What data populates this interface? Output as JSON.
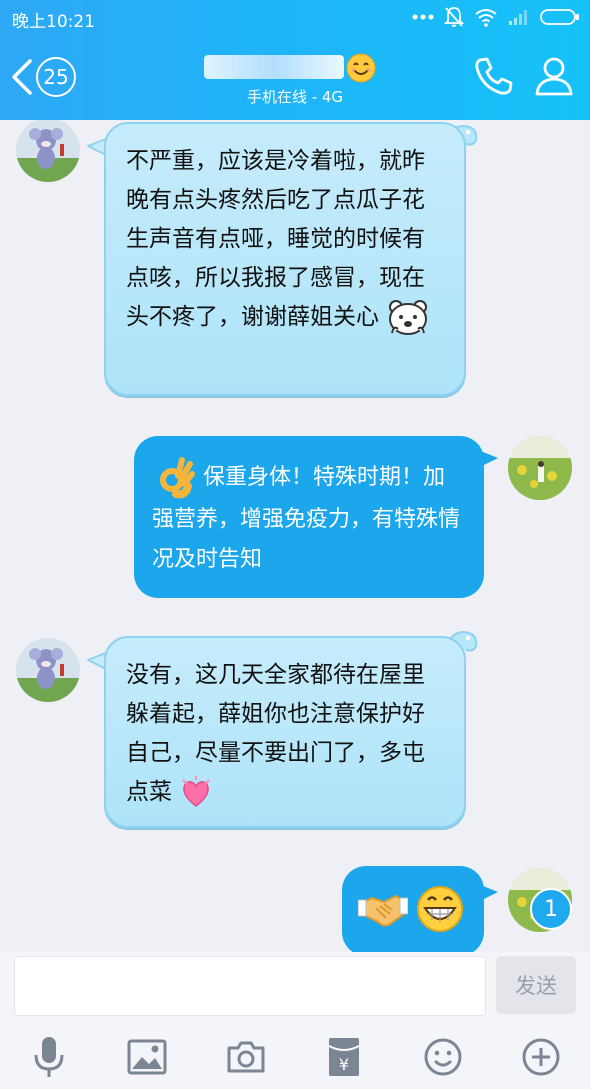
{
  "status_bar": {
    "time": "晚上10:21"
  },
  "header": {
    "unread_count": "25",
    "contact_status": "手机在线 - 4G"
  },
  "messages": [
    {
      "direction": "incoming",
      "text": "不严重，应该是冷着啦，就昨晚有点头疼然后吃了点瓜子花生声音有点哑，睡觉的时候有点咳，所以我报了感冒，现在头不疼了，谢谢薛姐关心"
    },
    {
      "direction": "outgoing",
      "text": "保重身体！特殊时期！加强营养，增强免疫力，有特殊情况及时告知"
    },
    {
      "direction": "incoming",
      "text": "没有，这几天全家都待在屋里躲着起，薛姐你也注意保护好自己，尽量不要出门了，多屯点菜"
    },
    {
      "direction": "outgoing",
      "text": ""
    }
  ],
  "new_message_count": "1",
  "composer": {
    "send_label": "发送",
    "input_value": ""
  },
  "colors": {
    "header_start": "#2ea8f5",
    "header_end": "#16c2f9",
    "outgoing_bubble": "#1ca7ec",
    "incoming_bubble": "#b8e7fa"
  }
}
